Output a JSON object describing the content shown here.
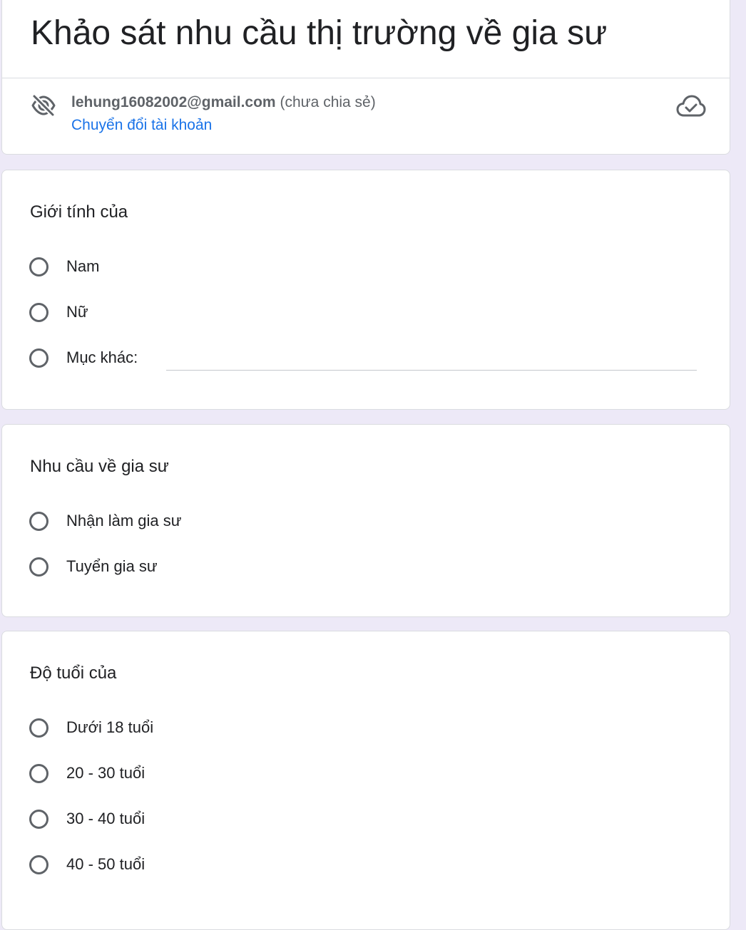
{
  "form": {
    "title": "Khảo sát nhu cầu thị trường về gia sư"
  },
  "account": {
    "email": "lehung16082002@gmail.com",
    "share_status": "(chưa chia sẻ)",
    "switch_label": "Chuyển đổi tài khoản"
  },
  "icons": {
    "hidden": "eye-off-icon",
    "saved": "cloud-done-icon"
  },
  "colors": {
    "background": "#ede9f7",
    "link": "#1a73e8",
    "radio_border": "#5f6368"
  },
  "questions": [
    {
      "title": "Giới tính của",
      "options": [
        "Nam",
        "Nữ",
        "Mục khác:"
      ]
    },
    {
      "title": "Nhu cầu về gia sư",
      "options": [
        "Nhận làm gia sư",
        "Tuyển gia sư"
      ]
    },
    {
      "title": "Độ tuổi của",
      "options": [
        "Dưới 18 tuổi",
        "20 - 30 tuổi",
        "30 - 40 tuổi",
        "40 - 50 tuổi"
      ]
    }
  ]
}
